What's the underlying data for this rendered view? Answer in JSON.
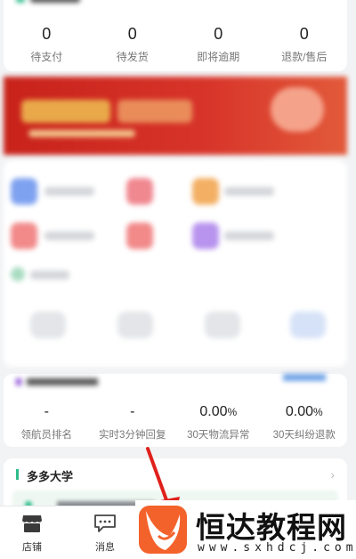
{
  "order_stats": [
    {
      "value": "0",
      "label": "待支付"
    },
    {
      "value": "0",
      "label": "待发货"
    },
    {
      "value": "0",
      "label": "即将逾期"
    },
    {
      "value": "0",
      "label": "退款/售后"
    }
  ],
  "metrics": [
    {
      "value": "-",
      "unit": "",
      "label": "领航员排名"
    },
    {
      "value": "-",
      "unit": "",
      "label": "实时3分钟回复"
    },
    {
      "value": "0.00",
      "unit": "%",
      "label": "30天物流异常"
    },
    {
      "value": "0.00",
      "unit": "%",
      "label": "30天纠纷退款"
    }
  ],
  "university": {
    "title": "多多大学",
    "arrow": "›"
  },
  "tabbar": {
    "shop_label": "店铺",
    "message_label": "消息"
  },
  "watermark": {
    "brand": "恒达教程网",
    "url": "www.sxhdcj.com"
  },
  "colors": {
    "accent_green": "#2ebc8a",
    "arrow_red": "#e0201b",
    "logo_orange": "#f4622c"
  }
}
